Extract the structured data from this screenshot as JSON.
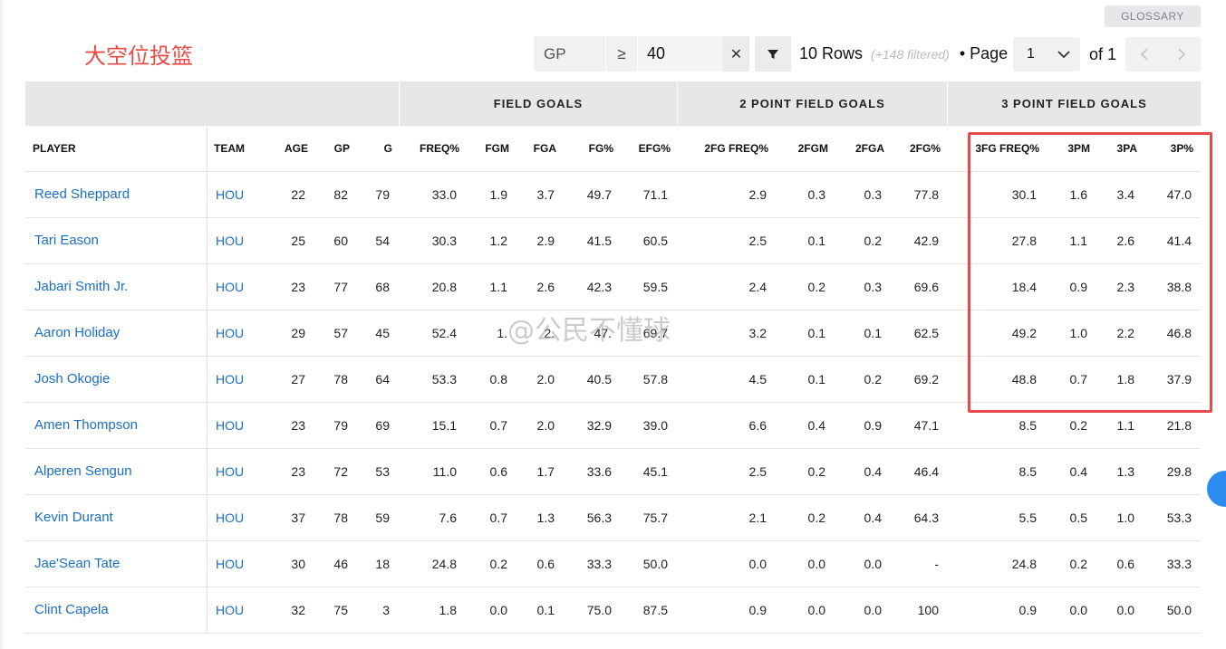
{
  "glossary_label": "GLOSSARY",
  "annotation_title": "大空位投篮",
  "watermark": "@公民不懂球",
  "filter": {
    "stat": "GP",
    "operator": "≥",
    "value": "40",
    "clear_icon": "close-icon",
    "apply_icon": "filter-icon"
  },
  "pagination": {
    "rows_text": "10 Rows",
    "filtered_text": "(+148 filtered)",
    "page_label": "• Page",
    "page_value": "1",
    "of_label": "of 1"
  },
  "group_headers": [
    "",
    "FIELD GOALS",
    "2 POINT FIELD GOALS",
    "3 POINT FIELD GOALS"
  ],
  "columns": [
    "PLAYER",
    "TEAM",
    "AGE",
    "GP",
    "G",
    "FREQ%",
    "FGM",
    "FGA",
    "FG%",
    "EFG%",
    "2FG FREQ%",
    "2FGM",
    "2FGA",
    "2FG%",
    "3FG FREQ%",
    "3PM",
    "3PA",
    "3P%"
  ],
  "rows": [
    [
      "Reed Sheppard",
      "HOU",
      "22",
      "82",
      "79",
      "33.0",
      "1.9",
      "3.7",
      "49.7",
      "71.1",
      "2.9",
      "0.3",
      "0.3",
      "77.8",
      "30.1",
      "1.6",
      "3.4",
      "47.0"
    ],
    [
      "Tari Eason",
      "HOU",
      "25",
      "60",
      "54",
      "30.3",
      "1.2",
      "2.9",
      "41.5",
      "60.5",
      "2.5",
      "0.1",
      "0.2",
      "42.9",
      "27.8",
      "1.1",
      "2.6",
      "41.4"
    ],
    [
      "Jabari Smith Jr.",
      "HOU",
      "23",
      "77",
      "68",
      "20.8",
      "1.1",
      "2.6",
      "42.3",
      "59.5",
      "2.4",
      "0.2",
      "0.3",
      "69.6",
      "18.4",
      "0.9",
      "2.3",
      "38.8"
    ],
    [
      "Aaron Holiday",
      "HOU",
      "29",
      "57",
      "45",
      "52.4",
      "1.",
      "2.",
      "47.",
      "69.7",
      "3.2",
      "0.1",
      "0.1",
      "62.5",
      "49.2",
      "1.0",
      "2.2",
      "46.8"
    ],
    [
      "Josh Okogie",
      "HOU",
      "27",
      "78",
      "64",
      "53.3",
      "0.8",
      "2.0",
      "40.5",
      "57.8",
      "4.5",
      "0.1",
      "0.2",
      "69.2",
      "48.8",
      "0.7",
      "1.8",
      "37.9"
    ],
    [
      "Amen Thompson",
      "HOU",
      "23",
      "79",
      "69",
      "15.1",
      "0.7",
      "2.0",
      "32.9",
      "39.0",
      "6.6",
      "0.4",
      "0.9",
      "47.1",
      "8.5",
      "0.2",
      "1.1",
      "21.8"
    ],
    [
      "Alperen Sengun",
      "HOU",
      "23",
      "72",
      "53",
      "11.0",
      "0.6",
      "1.7",
      "33.6",
      "45.1",
      "2.5",
      "0.2",
      "0.4",
      "46.4",
      "8.5",
      "0.4",
      "1.3",
      "29.8"
    ],
    [
      "Kevin Durant",
      "HOU",
      "37",
      "78",
      "59",
      "7.6",
      "0.7",
      "1.3",
      "56.3",
      "75.7",
      "2.1",
      "0.2",
      "0.4",
      "64.3",
      "5.5",
      "0.5",
      "1.0",
      "53.3"
    ],
    [
      "Jae'Sean Tate",
      "HOU",
      "30",
      "46",
      "18",
      "24.8",
      "0.2",
      "0.6",
      "33.3",
      "50.0",
      "0.0",
      "0.0",
      "0.0",
      "-",
      "24.8",
      "0.2",
      "0.6",
      "33.3"
    ],
    [
      "Clint Capela",
      "HOU",
      "32",
      "75",
      "3",
      "1.8",
      "0.0",
      "0.1",
      "75.0",
      "87.5",
      "0.9",
      "0.0",
      "0.0",
      "100",
      "0.9",
      "0.0",
      "0.0",
      "50.0"
    ]
  ],
  "colors": {
    "link": "#1a6fc4",
    "annotation": "#ea4b46",
    "header_bg": "#e6e7e9"
  }
}
